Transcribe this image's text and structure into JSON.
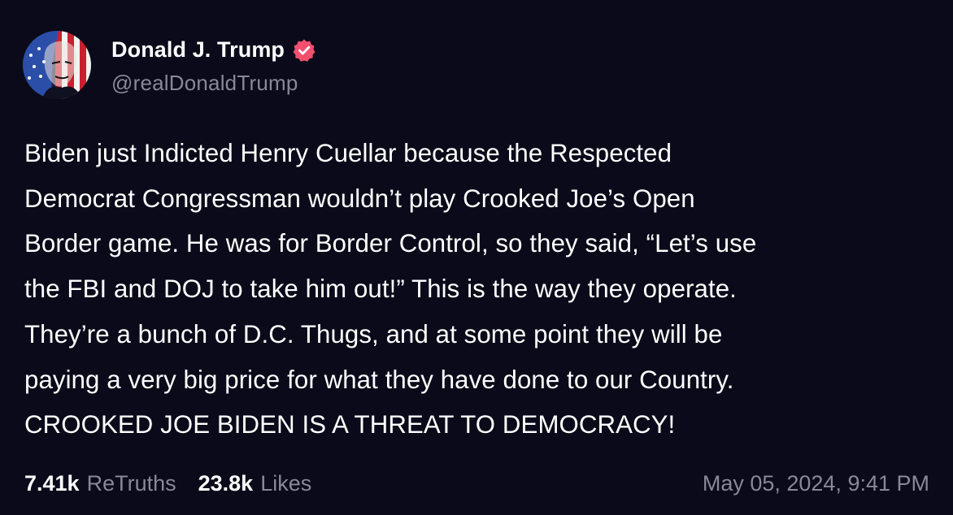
{
  "author": {
    "display_name": "Donald J. Trump",
    "handle": "@realDonaldTrump",
    "verified": true,
    "avatar_icon": "avatar-flag-portrait",
    "verified_icon": "verified-badge-icon"
  },
  "post": {
    "text": "Biden just Indicted Henry Cuellar because the Respected\nDemocrat Congressman wouldn’t play Crooked Joe’s Open\nBorder game. He was for Border Control, so they said, “Let’s use\nthe FBI and DOJ to take him out!” This is the way they operate.\nThey’re a bunch of D.C. Thugs, and at some point they will be\npaying a very big price for what they have done to our Country.\nCROOKED JOE BIDEN IS A THREAT TO DEMOCRACY!"
  },
  "stats": {
    "retruths_count": "7.41k",
    "retruths_label": "ReTruths",
    "likes_count": "23.8k",
    "likes_label": "Likes"
  },
  "timestamp": "May 05, 2024, 9:41 PM",
  "colors": {
    "background": "#0b0a1a",
    "text": "#ffffff",
    "muted": "#8a8797",
    "verified": "#f0506e"
  }
}
